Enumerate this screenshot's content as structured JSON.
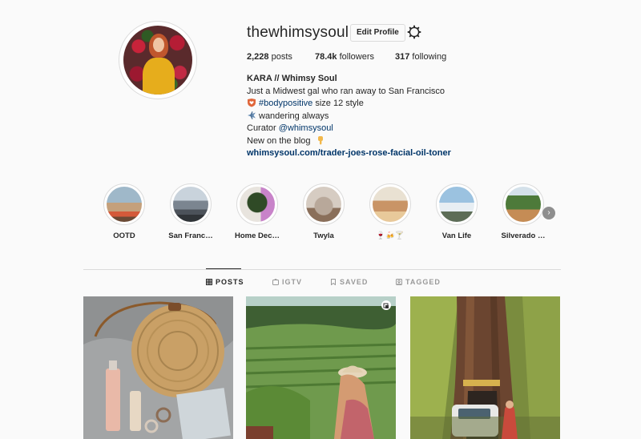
{
  "profile": {
    "username": "thewhimsysoul",
    "edit_label": "Edit Profile",
    "stats": {
      "posts_num": "2,228",
      "posts_label": " posts",
      "followers_num": "78.4k",
      "followers_label": " followers",
      "following_num": "317",
      "following_label": " following"
    },
    "bio": {
      "name": "KARA // Whimsy Soul",
      "line1": "Just a Midwest gal who ran away to San Francisco",
      "line2_tag": "#bodypositive",
      "line2_rest": " size 12 style",
      "line3": "wandering always",
      "line4_prefix": "Curator ",
      "line4_mention": "@whimsysoul",
      "line5": "New on the blog",
      "link": "whimsysoul.com/trader-joes-rose-facial-oil-toner"
    }
  },
  "highlights": [
    {
      "label": "OOTD"
    },
    {
      "label": "San Franc…"
    },
    {
      "label": "Home Dec…"
    },
    {
      "label": "Twyla"
    },
    {
      "label": "🍷🍻🍸"
    },
    {
      "label": "Van Life"
    },
    {
      "label": "Silverado …"
    }
  ],
  "tabs": {
    "posts": "POSTS",
    "igtv": "IGTV",
    "saved": "SAVED",
    "tagged": "TAGGED"
  },
  "posts": [
    {
      "name": "post-bag-skincare"
    },
    {
      "name": "post-vineyard"
    },
    {
      "name": "post-redwood-van"
    }
  ],
  "colors": {
    "link": "#003569",
    "text": "#262626",
    "muted": "#999999",
    "border": "#dbdbdb",
    "background": "#fafafa"
  }
}
